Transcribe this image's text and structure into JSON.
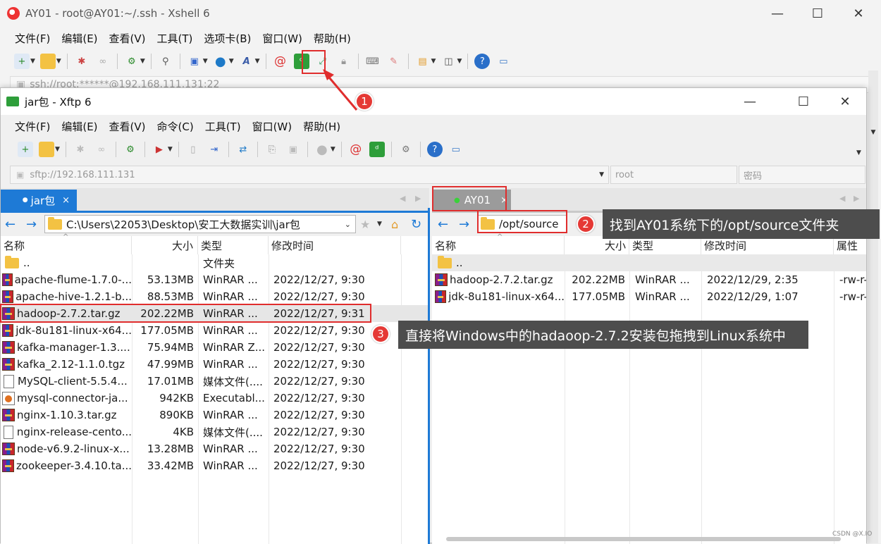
{
  "xshell": {
    "title": "AY01 - root@AY01:~/.ssh - Xshell 6",
    "menu": [
      "文件(F)",
      "编辑(E)",
      "查看(V)",
      "工具(T)",
      "选项卡(B)",
      "窗口(W)",
      "帮助(H)"
    ],
    "session_address": "ssh://root:******@192.168.111.131:22"
  },
  "xftp": {
    "title": "jar包 - Xftp 6",
    "menu": [
      "文件(F)",
      "编辑(E)",
      "查看(V)",
      "命令(C)",
      "工具(T)",
      "窗口(W)",
      "帮助(H)"
    ],
    "host_placeholder": "sftp://192.168.111.131",
    "user_placeholder": "root",
    "password_placeholder": "密码"
  },
  "left_pane": {
    "tab": "jar包",
    "tab_close": "×",
    "path": "C:\\Users\\22053\\Desktop\\安工大数据实训\\jar包",
    "columns": [
      "名称",
      "大小",
      "类型",
      "修改时间"
    ],
    "files": [
      {
        "name": "..",
        "size": "",
        "type": "文件夹",
        "modified": "",
        "icon": "folder"
      },
      {
        "name": "apache-flume-1.7.0-...",
        "size": "53.13MB",
        "type": "WinRAR ...",
        "modified": "2022/12/27, 9:30",
        "icon": "rar"
      },
      {
        "name": "apache-hive-1.2.1-b...",
        "size": "88.53MB",
        "type": "WinRAR ...",
        "modified": "2022/12/27, 9:30",
        "icon": "rar"
      },
      {
        "name": "hadoop-2.7.2.tar.gz",
        "size": "202.22MB",
        "type": "WinRAR ...",
        "modified": "2022/12/27, 9:31",
        "icon": "rar"
      },
      {
        "name": "jdk-8u181-linux-x64...",
        "size": "177.05MB",
        "type": "WinRAR ...",
        "modified": "2022/12/27, 9:30",
        "icon": "rar"
      },
      {
        "name": "kafka-manager-1.3....",
        "size": "75.94MB",
        "type": "WinRAR Z...",
        "modified": "2022/12/27, 9:30",
        "icon": "rar"
      },
      {
        "name": "kafka_2.12-1.1.0.tgz",
        "size": "47.99MB",
        "type": "WinRAR ...",
        "modified": "2022/12/27, 9:30",
        "icon": "rar"
      },
      {
        "name": "MySQL-client-5.5.4...",
        "size": "17.01MB",
        "type": "媒体文件(....",
        "modified": "2022/12/27, 9:30",
        "icon": "doc"
      },
      {
        "name": "mysql-connector-ja...",
        "size": "942KB",
        "type": "Executabl...",
        "modified": "2022/12/27, 9:30",
        "icon": "jar"
      },
      {
        "name": "nginx-1.10.3.tar.gz",
        "size": "890KB",
        "type": "WinRAR ...",
        "modified": "2022/12/27, 9:30",
        "icon": "rar"
      },
      {
        "name": "nginx-release-cento...",
        "size": "4KB",
        "type": "媒体文件(....",
        "modified": "2022/12/27, 9:30",
        "icon": "doc"
      },
      {
        "name": "node-v6.9.2-linux-x...",
        "size": "13.28MB",
        "type": "WinRAR ...",
        "modified": "2022/12/27, 9:30",
        "icon": "rar"
      },
      {
        "name": "zookeeper-3.4.10.ta...",
        "size": "33.42MB",
        "type": "WinRAR ...",
        "modified": "2022/12/27, 9:30",
        "icon": "rar"
      }
    ]
  },
  "right_pane": {
    "tab": "AY01",
    "tab_close": "×",
    "path": "/opt/source",
    "columns": [
      "名称",
      "大小",
      "类型",
      "修改时间",
      "属性"
    ],
    "files": [
      {
        "name": "..",
        "size": "",
        "type": "",
        "modified": "",
        "attr": "",
        "icon": "folder"
      },
      {
        "name": "hadoop-2.7.2.tar.gz",
        "size": "202.22MB",
        "type": "WinRAR ...",
        "modified": "2022/12/29, 2:35",
        "attr": "-rw-r-",
        "icon": "rar"
      },
      {
        "name": "jdk-8u181-linux-x64...",
        "size": "177.05MB",
        "type": "WinRAR ...",
        "modified": "2022/12/29, 1:07",
        "attr": "-rw-r-",
        "icon": "rar"
      }
    ]
  },
  "annotations": {
    "step1": "1",
    "step2": "2",
    "step3": "3",
    "step2_text": "找到AY01系统下的/opt/source文件夹",
    "step3_text": "直接将Windows中的hadaoop-2.7.2安装包拖拽到Linux系统中"
  },
  "watermark": "CSDN @X.IO"
}
